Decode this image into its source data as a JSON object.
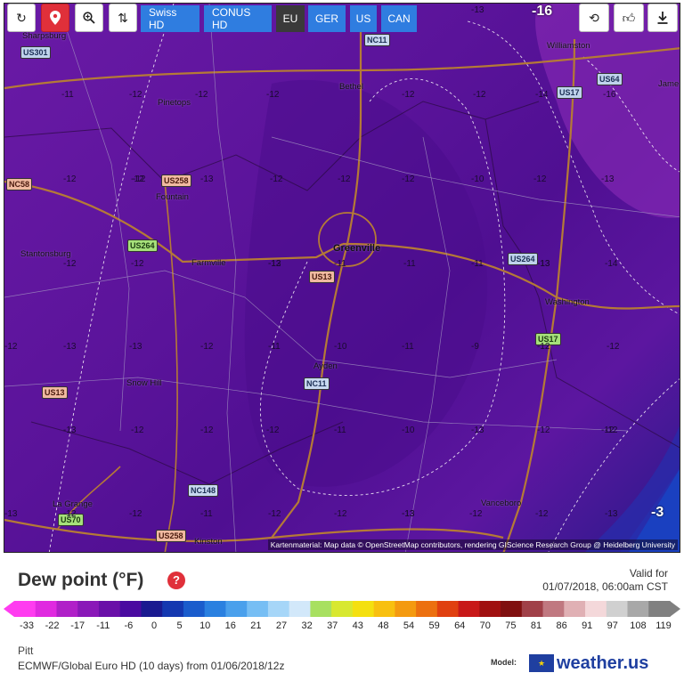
{
  "toolbar": {
    "refresh_icon": "refresh-icon",
    "location_icon": "location-pin-icon",
    "zoom_icon": "zoom-icon",
    "sort_icon": "sort-arrows-icon",
    "tabs": [
      {
        "label": "Swiss HD",
        "active": false
      },
      {
        "label": "CONUS HD",
        "active": false
      },
      {
        "label": "EU",
        "active": true
      },
      {
        "label": "GER",
        "active": false
      },
      {
        "label": "US",
        "active": false
      },
      {
        "label": "CAN",
        "active": false
      }
    ],
    "corner_value": "-16",
    "top_value": "-13",
    "repeat_icon": "repeat-icon",
    "like_icon": "thumbs-up-icon",
    "download_icon": "download-icon"
  },
  "map": {
    "places": [
      {
        "name": "Sharpsburg",
        "big": false
      },
      {
        "name": "Williamston",
        "big": false
      },
      {
        "name": "Jame",
        "big": false
      },
      {
        "name": "Bethel",
        "big": false
      },
      {
        "name": "Pinetops",
        "big": false
      },
      {
        "name": "Fountain",
        "big": false
      },
      {
        "name": "Greenville",
        "big": true
      },
      {
        "name": "Stantonsburg",
        "big": false
      },
      {
        "name": "Farmville",
        "big": false
      },
      {
        "name": "Washington",
        "big": false
      },
      {
        "name": "Ayden",
        "big": false
      },
      {
        "name": "Snow Hill",
        "big": false
      },
      {
        "name": "La Grange",
        "big": false
      },
      {
        "name": "Kinston",
        "big": false
      },
      {
        "name": "Vanceboro",
        "big": false
      }
    ],
    "shields": [
      {
        "label": "US301",
        "type": "us"
      },
      {
        "label": "NC11",
        "type": "nc"
      },
      {
        "label": "US17",
        "type": "us"
      },
      {
        "label": "US64",
        "type": "us"
      },
      {
        "label": "US258",
        "type": "usr"
      },
      {
        "label": "NC58",
        "type": "usr"
      },
      {
        "label": "US264",
        "type": "usg"
      },
      {
        "label": "US264",
        "type": "us"
      },
      {
        "label": "US13",
        "type": "usr"
      },
      {
        "label": "US17",
        "type": "usg"
      },
      {
        "label": "NC11",
        "type": "nc"
      },
      {
        "label": "US13",
        "type": "usr"
      },
      {
        "label": "NC148",
        "type": "nc"
      },
      {
        "label": "US70",
        "type": "usg"
      },
      {
        "label": "US258",
        "type": "usr"
      }
    ],
    "contour_values": [
      "-11",
      "-12",
      "-12",
      "-12",
      "-12",
      "-12",
      "-14",
      "-16",
      "-12",
      "-12",
      "-13",
      "-12",
      "-12",
      "-12",
      "-10",
      "-12",
      "-13",
      "-12",
      "-12",
      "-13",
      "-13",
      "-11",
      "-11",
      "-13",
      "-14",
      "-12",
      "-13",
      "-13",
      "-12",
      "-11",
      "-10",
      "-11",
      "-9",
      "-12",
      "-13",
      "-12",
      "-12",
      "-12",
      "-11",
      "-10",
      "-13",
      "-12",
      "-12",
      "-13",
      "-12",
      "-12",
      "-11",
      "-12",
      "-12",
      "-13",
      "-12",
      "-12",
      "-13",
      "-12",
      "-12",
      "-11",
      "-12",
      "-13",
      "-12"
    ],
    "bottom_right_value": "-3",
    "attribution": "Kartenmaterial: Map data © OpenStreetMap contributors, rendering GIScience Research Group @ Heidelberg University"
  },
  "legend": {
    "title": "Dew point (°F)",
    "help_icon": "?",
    "valid_label": "Valid for",
    "valid_date": "01/07/2018, 06:00am CST",
    "ticks": [
      "-33",
      "-22",
      "-17",
      "-11",
      "-6",
      "0",
      "5",
      "10",
      "16",
      "21",
      "27",
      "32",
      "37",
      "43",
      "48",
      "54",
      "59",
      "64",
      "70",
      "75",
      "81",
      "86",
      "91",
      "97",
      "108",
      "119"
    ],
    "colors": [
      "#ff3cf0",
      "#e02ae0",
      "#b020c8",
      "#8a18b8",
      "#6a10a8",
      "#4a0aa0",
      "#1a1a90",
      "#1438b0",
      "#1a5ccc",
      "#2a80e0",
      "#4aa0ec",
      "#76bef4",
      "#a6d6f8",
      "#d2e8fa",
      "#a8e060",
      "#d8e830",
      "#f4e010",
      "#f8c010",
      "#f49a10",
      "#ec7010",
      "#e04010",
      "#c81818",
      "#a01010",
      "#801010",
      "#a04048",
      "#c07880",
      "#e0b0b4",
      "#f4d8da",
      "#d0d0d0",
      "#a8a8a8",
      "#808080"
    ]
  },
  "info": {
    "location": "Pitt",
    "model_desc": "ECMWF/Global Euro HD (10 days) from 01/06/2018/12z",
    "model_label": "Model:",
    "brand": "weather.us"
  }
}
